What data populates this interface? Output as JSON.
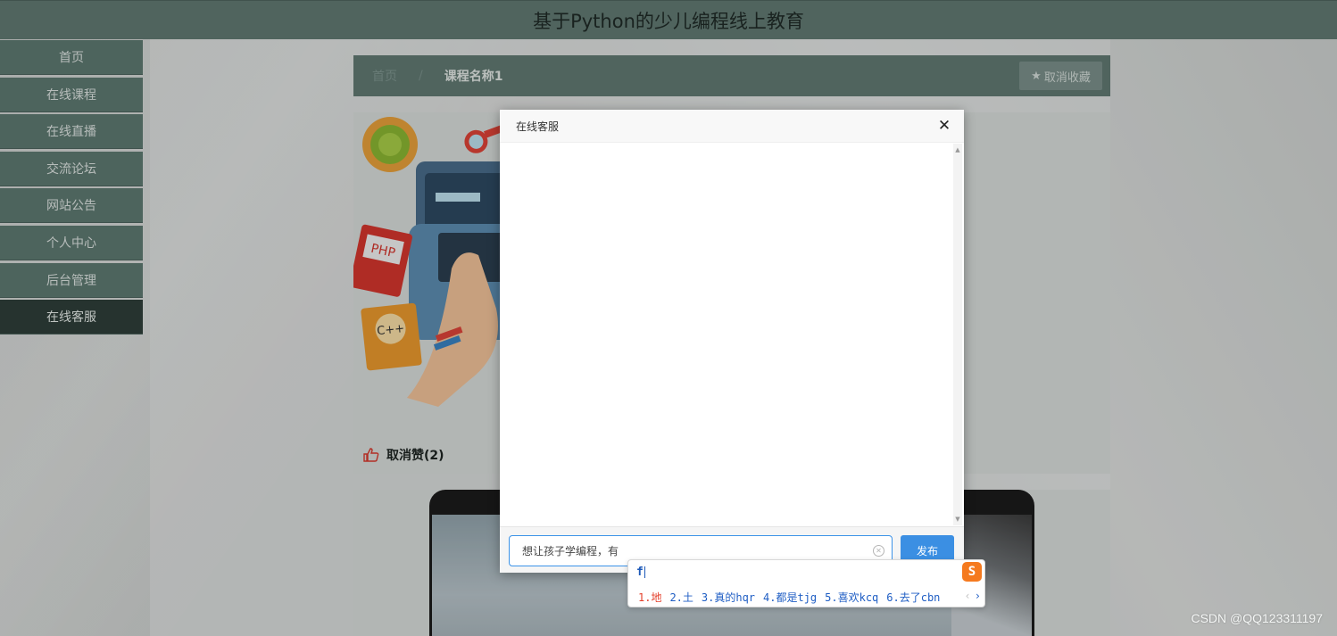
{
  "header": {
    "title": "基于Python的少儿编程线上教育"
  },
  "sidebar": {
    "items": [
      {
        "label": "首页"
      },
      {
        "label": "在线课程"
      },
      {
        "label": "在线直播"
      },
      {
        "label": "交流论坛"
      },
      {
        "label": "网站公告"
      },
      {
        "label": "个人中心"
      },
      {
        "label": "后台管理"
      },
      {
        "label": "在线客服",
        "active": true
      }
    ]
  },
  "breadcrumb": {
    "home": "首页",
    "separator": "/",
    "current": "课程名称1"
  },
  "actions": {
    "unfavorite_label": "取消收藏",
    "star_icon": "★"
  },
  "like": {
    "label": "取消赞(2)"
  },
  "modal": {
    "title": "在线客服",
    "close_icon": "✕",
    "input_value": "想让孩子学编程，有",
    "send_label": "发布"
  },
  "ime": {
    "composition": "f",
    "candidates": [
      "1.地",
      "2.土",
      "3.真的hqr",
      "4.都是tjg",
      "5.喜欢kcq",
      "6.去了cbn"
    ],
    "prev": "‹",
    "next": "›"
  },
  "watermark": "CSDN @QQ123311197",
  "colors": {
    "header_bg": "#627a73",
    "sidebar_bg": "#5f7a72",
    "sidebar_active": "#2f3f3a",
    "primary_button": "#3b8fe3",
    "ime_logo": "#f57a1f"
  }
}
